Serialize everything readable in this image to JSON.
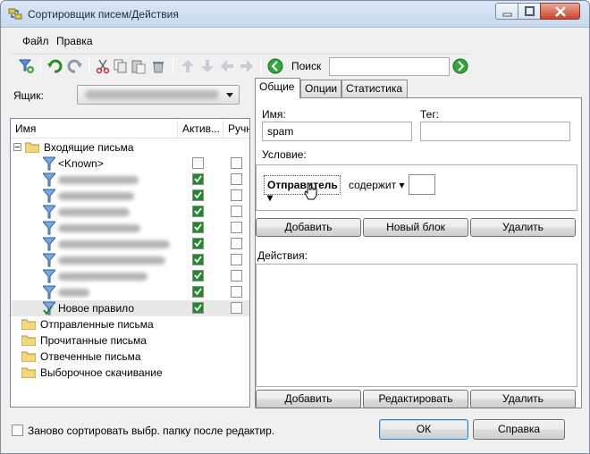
{
  "window": {
    "title": "Сортировщик писем/Действия"
  },
  "menu": [
    "Файл",
    "Правка"
  ],
  "toolbar": {
    "icons": [
      "new-filter-icon",
      "undo-icon",
      "redo-icon",
      "cut-icon",
      "copy-icon",
      "paste-icon",
      "delete-icon",
      "move-up-icon",
      "move-down-icon",
      "move-left-icon",
      "move-right-icon",
      "search-prev-icon",
      "search-next-icon"
    ],
    "search_label": "Поиск",
    "search_value": ""
  },
  "mailbox": {
    "label": "Ящик:",
    "value": ""
  },
  "tree": {
    "columns": [
      "Имя",
      "Актив...",
      "Ручн"
    ],
    "inbox_label": "Входящие письма",
    "rules": [
      {
        "label": "<Known>",
        "active": false,
        "blurred": false
      },
      {
        "label": "",
        "active": true,
        "blurred": true
      },
      {
        "label": "",
        "active": true,
        "blurred": true
      },
      {
        "label": "",
        "active": true,
        "blurred": true
      },
      {
        "label": "",
        "active": true,
        "blurred": true
      },
      {
        "label": "",
        "active": true,
        "blurred": true
      },
      {
        "label": "",
        "active": true,
        "blurred": true
      },
      {
        "label": "",
        "active": true,
        "blurred": true
      },
      {
        "label": "",
        "active": true,
        "blurred": true
      },
      {
        "label": "Новое правило",
        "active": true,
        "blurred": false,
        "selected": true
      }
    ],
    "folders": [
      "Отправленные письма",
      "Прочитанные письма",
      "Отвеченные письма",
      "Выборочное скачивание"
    ]
  },
  "tabs": [
    "Общие",
    "Опции",
    "Статистика"
  ],
  "general": {
    "name_label": "Имя:",
    "name_value": "spam",
    "tag_label": "Тег:",
    "tag_value": "",
    "condition_label": "Условие:",
    "condition_field": "Отправитель",
    "condition_operator": "содержит",
    "condition_value": "",
    "actions_label": "Действия:"
  },
  "condition_buttons": [
    "Добавить",
    "Новый блок",
    "Удалить"
  ],
  "action_buttons": [
    "Добавить",
    "Редактировать",
    "Удалить"
  ],
  "footer": {
    "resort_label": "Заново сортировать выбр. папку после редактир.",
    "resort_checked": false,
    "ok_label": "ОК",
    "help_label": "Справка"
  }
}
